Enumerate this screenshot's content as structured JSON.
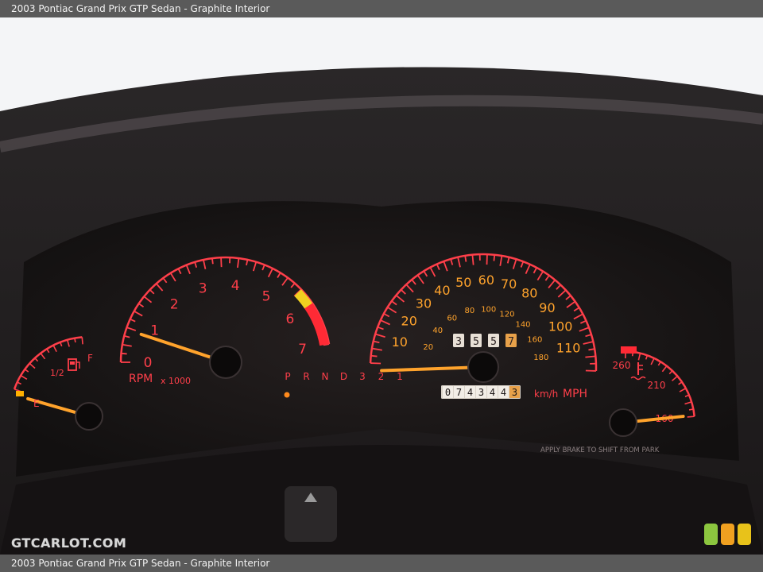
{
  "caption": {
    "top": "2003 Pontiac Grand Prix GTP Sedan - Graphite Interior",
    "bottom": "2003 Pontiac Grand Prix GTP Sedan - Graphite Interior"
  },
  "watermark": {
    "text": "GTCARLOT.COM",
    "light_colors": [
      "#8cc63f",
      "#f0a020",
      "#e8c21a"
    ]
  },
  "colors": {
    "red": "#ff3f4a",
    "orange": "#ffa32c",
    "dash": "#1c1616"
  },
  "fuel_gauge": {
    "empty": "E",
    "half": "1/2",
    "full": "F",
    "icon": "fuel-pump-icon",
    "level": 0.0
  },
  "tachometer": {
    "labels": [
      "0",
      "1",
      "2",
      "3",
      "4",
      "5",
      "6",
      "7"
    ],
    "unit": "RPM",
    "multiplier": "x 1000",
    "reading": 1.0,
    "max": 7
  },
  "speedometer": {
    "mph_labels": [
      "10",
      "20",
      "30",
      "40",
      "50",
      "60",
      "70",
      "80",
      "90",
      "100",
      "110"
    ],
    "kmh_labels": [
      "20",
      "40",
      "60",
      "80",
      "100",
      "120",
      "140",
      "160",
      "180"
    ],
    "unit_kmh": "km/h",
    "unit_mph": "MPH",
    "reading_mph": 0
  },
  "trip_odometer": [
    "3",
    "5",
    "5",
    "7"
  ],
  "odometer": [
    "0",
    "7",
    "4",
    "3",
    "4",
    "4",
    "3"
  ],
  "gear_indicator": [
    "P",
    "R",
    "N",
    "D",
    "3",
    "2",
    "1"
  ],
  "temp_gauge": {
    "labels": [
      "160",
      "210",
      "260"
    ],
    "icon": "coolant-temp-icon"
  },
  "notice": "APPLY BRAKE TO SHIFT FROM PARK"
}
